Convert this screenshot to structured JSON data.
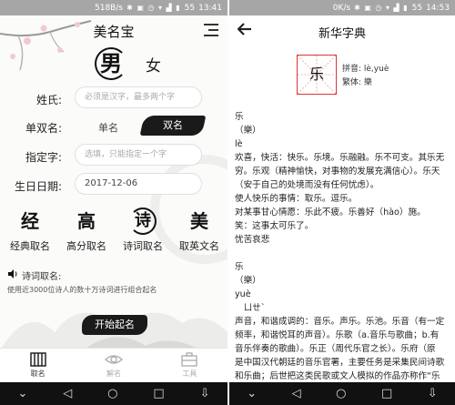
{
  "left": {
    "status": {
      "speed": "518B/s",
      "icons": "✱ ▣ ◷ ▾ ▟ ▮",
      "battery": "55",
      "time": "13:41"
    },
    "app_title": "美名宝",
    "gender": {
      "male": "男",
      "female": "女"
    },
    "surname": {
      "label": "姓氏:",
      "placeholder": "必须是汉字，最多两个字"
    },
    "name_type": {
      "label": "单双名:",
      "single": "单名",
      "double": "双名"
    },
    "fixed_char": {
      "label": "指定字:",
      "placeholder": "选填，只能指定一个字"
    },
    "birthday": {
      "label": "生日日期:",
      "value": "2017-12-06"
    },
    "methods": [
      {
        "glyph": "经",
        "label": "经典取名"
      },
      {
        "glyph": "高",
        "label": "高分取名"
      },
      {
        "glyph": "诗",
        "label": "诗词取名"
      },
      {
        "glyph": "美",
        "label": "取英文名"
      }
    ],
    "poem": {
      "title": "诗词取名:",
      "desc": "使用近3000位诗人的数十万诗词进行组合起名"
    },
    "start_button": "开始起名",
    "tabs": [
      {
        "label": "取名"
      },
      {
        "label": "解名"
      },
      {
        "label": "工具"
      }
    ]
  },
  "right": {
    "status": {
      "speed": "0K/s",
      "icons": "✱ ▣ ◷ ▾ ▟ ▮",
      "battery": "55",
      "time": "14:53"
    },
    "title": "新华字典",
    "character": "乐",
    "pinyin": "拼音: lè,yuè",
    "traditional": "繁体: 樂",
    "definition_lines": [
      "乐",
      "（樂）",
      "lè",
      "欢喜，快活：快乐。乐境。乐融融。乐不可支。其乐无",
      "穷。乐观（精神愉快，对事物的发展充满信心）。乐天",
      "（安于自己的处境而没有任何忧虑）。",
      "使人快乐的事情：取乐。逗乐。",
      "对某事甘心情愿：乐此不疲。乐善好（hào）施。",
      "笑：这事太可乐了。",
      "忧苦哀悲",
      "",
      "乐",
      "（樂）",
      "yuè",
      "　ㄩㄝˋ",
      "声音，和谐成调的：音乐。声乐。乐池。乐音（有一定",
      "频率，和谐悦耳的声音）。乐歌（a.音乐与歌曲；b.有",
      "音乐伴奏的歌曲）。乐正（周代乐官之长）。乐府（原",
      "是中国汉代朝廷的音乐官署，主要任务是采集民间诗歌",
      "和乐曲；后世把这类民歌或文人模拟的作品亦称作“乐"
    ]
  }
}
